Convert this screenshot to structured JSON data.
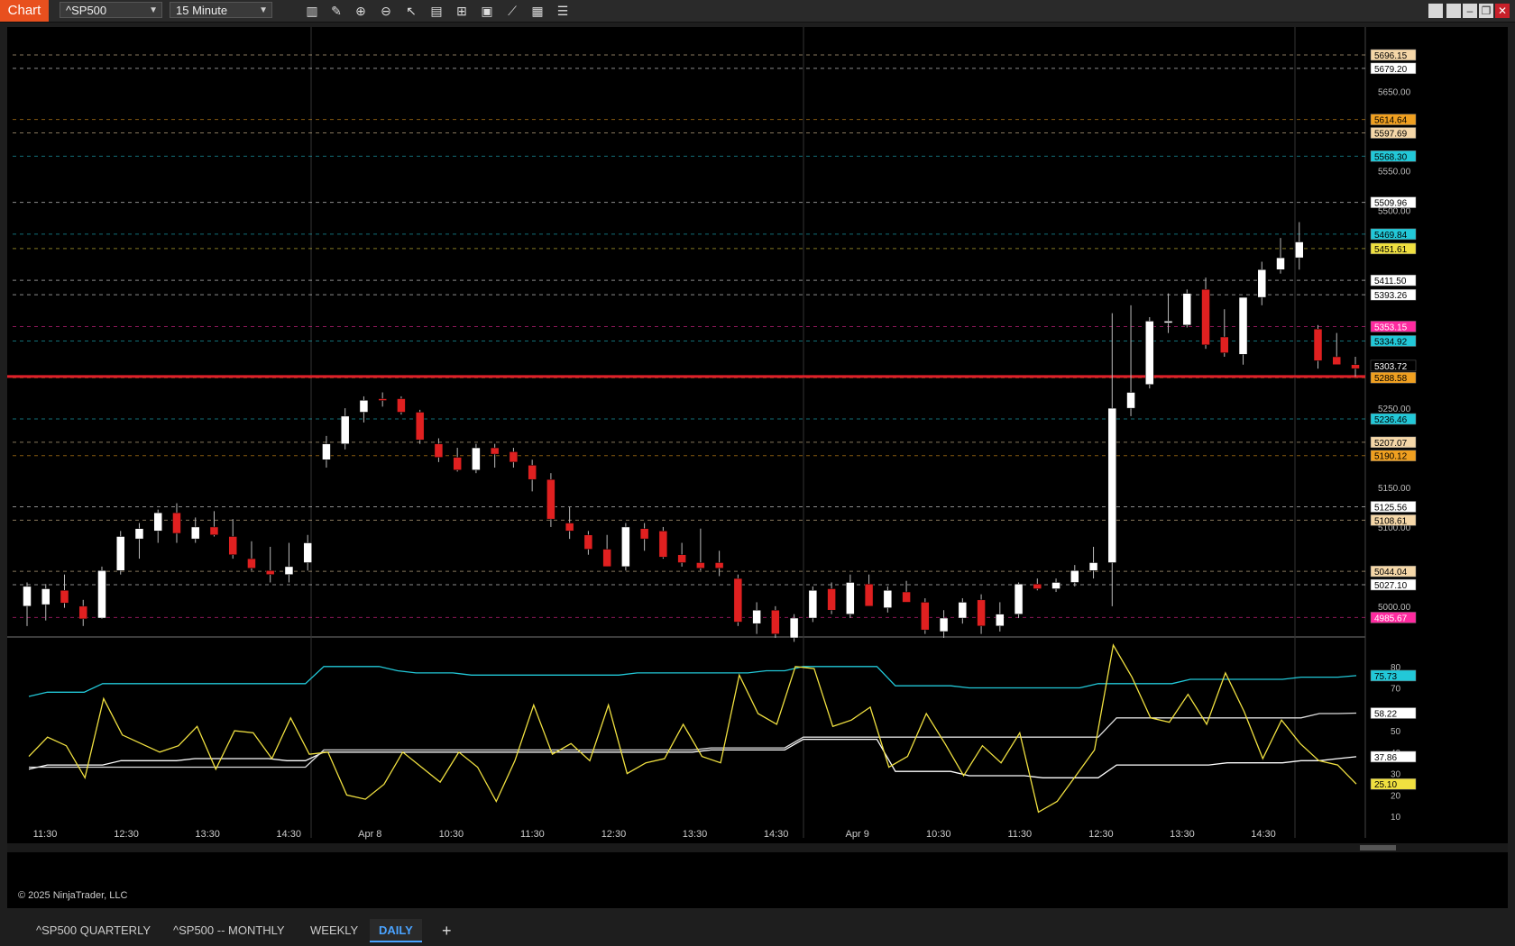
{
  "toolbar": {
    "chart_tab": "Chart",
    "instrument": "^SP500",
    "interval": "15 Minute",
    "tools": [
      "bar-type-icon",
      "draw-icon",
      "zoom-in-icon",
      "zoom-out-icon",
      "pointer-icon",
      "data-box-icon",
      "chart-style-icon",
      "indicators-icon",
      "strategies-icon",
      "properties-icon",
      "more-icon"
    ]
  },
  "price_axis": {
    "ticks": [
      {
        "v": 5650,
        "t": "5650.00"
      },
      {
        "v": 5550,
        "t": "5550.00"
      },
      {
        "v": 5500,
        "t": "5500.00"
      },
      {
        "v": 5250,
        "t": "5250.00"
      },
      {
        "v": 5150,
        "t": "5150.00"
      },
      {
        "v": 5100,
        "t": "5100.00"
      },
      {
        "v": 5000,
        "t": "5000.00"
      }
    ],
    "labels": [
      {
        "v": 5696.15,
        "t": "5696.15",
        "bg": "#f5d7a8",
        "fg": "#000"
      },
      {
        "v": 5679.2,
        "t": "5679.20",
        "bg": "#ffffff",
        "fg": "#000"
      },
      {
        "v": 5614.64,
        "t": "5614.64",
        "bg": "#f0a020",
        "fg": "#000"
      },
      {
        "v": 5597.69,
        "t": "5597.69",
        "bg": "#f5d7a8",
        "fg": "#000"
      },
      {
        "v": 5568.3,
        "t": "5568.30",
        "bg": "#22c8d8",
        "fg": "#000"
      },
      {
        "v": 5509.96,
        "t": "5509.96",
        "bg": "#ffffff",
        "fg": "#000"
      },
      {
        "v": 5469.84,
        "t": "5469.84",
        "bg": "#22c8d8",
        "fg": "#000"
      },
      {
        "v": 5451.61,
        "t": "5451.61",
        "bg": "#f0e040",
        "fg": "#000"
      },
      {
        "v": 5411.5,
        "t": "5411.50",
        "bg": "#ffffff",
        "fg": "#000"
      },
      {
        "v": 5393.26,
        "t": "5393.26",
        "bg": "#ffffff",
        "fg": "#000"
      },
      {
        "v": 5353.15,
        "t": "5353.15",
        "bg": "#ff2aa0",
        "fg": "#fff"
      },
      {
        "v": 5334.92,
        "t": "5334.92",
        "bg": "#22c8d8",
        "fg": "#000"
      },
      {
        "v": 5303.72,
        "t": "5303.72",
        "bg": "#000000",
        "fg": "#fff"
      },
      {
        "v": 5288.58,
        "t": "5288.58",
        "bg": "#f0a020",
        "fg": "#000"
      },
      {
        "v": 5236.46,
        "t": "5236.46",
        "bg": "#22c8d8",
        "fg": "#000"
      },
      {
        "v": 5207.07,
        "t": "5207.07",
        "bg": "#f5d7a8",
        "fg": "#000"
      },
      {
        "v": 5190.12,
        "t": "5190.12",
        "bg": "#f0a020",
        "fg": "#000"
      },
      {
        "v": 5125.56,
        "t": "5125.56",
        "bg": "#ffffff",
        "fg": "#000"
      },
      {
        "v": 5108.61,
        "t": "5108.61",
        "bg": "#f5d7a8",
        "fg": "#000"
      },
      {
        "v": 5044.04,
        "t": "5044.04",
        "bg": "#f5d7a8",
        "fg": "#000"
      },
      {
        "v": 5027.1,
        "t": "5027.10",
        "bg": "#ffffff",
        "fg": "#000"
      },
      {
        "v": 4985.67,
        "t": "4985.67",
        "bg": "#ff2aa0",
        "fg": "#fff"
      }
    ]
  },
  "indicator_axis": {
    "ticks": [
      {
        "v": 80,
        "t": "80"
      },
      {
        "v": 70,
        "t": "70"
      },
      {
        "v": 50,
        "t": "50"
      },
      {
        "v": 40,
        "t": "40"
      },
      {
        "v": 30,
        "t": "30"
      },
      {
        "v": 20,
        "t": "20"
      },
      {
        "v": 10,
        "t": "10"
      }
    ],
    "labels": [
      {
        "v": 75.73,
        "t": "75.73",
        "bg": "#22c8d8",
        "fg": "#000"
      },
      {
        "v": 58.22,
        "t": "58.22",
        "bg": "#ffffff",
        "fg": "#000"
      },
      {
        "v": 37.86,
        "t": "37.86",
        "bg": "#ffffff",
        "fg": "#000"
      },
      {
        "v": 25.1,
        "t": "25.10",
        "bg": "#f0e040",
        "fg": "#000"
      }
    ]
  },
  "time_axis": [
    "11:30",
    "12:30",
    "13:30",
    "14:30",
    "Apr 8",
    "10:30",
    "11:30",
    "12:30",
    "13:30",
    "14:30",
    "Apr 9",
    "10:30",
    "11:30",
    "12:30",
    "13:30",
    "14:30"
  ],
  "copyright": "© 2025 NinjaTrader, LLC",
  "tabs": [
    {
      "label": "^SP500 QUARTERLY",
      "active": false
    },
    {
      "label": "^SP500 -- MONTHLY",
      "active": false
    },
    {
      "label": "WEEKLY",
      "active": false
    },
    {
      "label": "DAILY",
      "active": true
    }
  ],
  "add_tab": "+",
  "colors": {
    "up": "#ffffff",
    "down": "#e02020",
    "background": "#000000",
    "price_line": "#e0202a",
    "cyan": "#22c8d8",
    "orange": "#f0a020",
    "tan": "#e8c898",
    "yellow": "#f0e040",
    "magenta": "#ff2aa0"
  },
  "chart_data": {
    "type": "candlestick",
    "price_range": [
      4960,
      5720
    ],
    "indicator_range": [
      5,
      90
    ],
    "last_price": 5303.72,
    "candles": [
      {
        "o": 5000,
        "h": 5030,
        "l": 4975,
        "c": 5025
      },
      {
        "o": 5002,
        "h": 5028,
        "l": 4982,
        "c": 5022
      },
      {
        "o": 5020,
        "h": 5040,
        "l": 4998,
        "c": 5004
      },
      {
        "o": 5000,
        "h": 5008,
        "l": 4975,
        "c": 4984
      },
      {
        "o": 4985,
        "h": 5050,
        "l": 4984,
        "c": 5045
      },
      {
        "o": 5045,
        "h": 5095,
        "l": 5040,
        "c": 5088
      },
      {
        "o": 5085,
        "h": 5105,
        "l": 5060,
        "c": 5098
      },
      {
        "o": 5095,
        "h": 5122,
        "l": 5080,
        "c": 5118
      },
      {
        "o": 5118,
        "h": 5130,
        "l": 5080,
        "c": 5092
      },
      {
        "o": 5085,
        "h": 5112,
        "l": 5080,
        "c": 5100
      },
      {
        "o": 5100,
        "h": 5120,
        "l": 5088,
        "c": 5090
      },
      {
        "o": 5088,
        "h": 5110,
        "l": 5060,
        "c": 5065
      },
      {
        "o": 5060,
        "h": 5082,
        "l": 5045,
        "c": 5048
      },
      {
        "o": 5045,
        "h": 5075,
        "l": 5030,
        "c": 5040
      },
      {
        "o": 5040,
        "h": 5080,
        "l": 5030,
        "c": 5050
      },
      {
        "o": 5055,
        "h": 5090,
        "l": 5045,
        "c": 5080
      },
      {
        "o": 5185,
        "h": 5215,
        "l": 5175,
        "c": 5205
      },
      {
        "o": 5205,
        "h": 5250,
        "l": 5198,
        "c": 5240
      },
      {
        "o": 5245,
        "h": 5265,
        "l": 5232,
        "c": 5260
      },
      {
        "o": 5262,
        "h": 5270,
        "l": 5252,
        "c": 5260
      },
      {
        "o": 5262,
        "h": 5265,
        "l": 5242,
        "c": 5245
      },
      {
        "o": 5245,
        "h": 5248,
        "l": 5205,
        "c": 5210
      },
      {
        "o": 5205,
        "h": 5212,
        "l": 5182,
        "c": 5188
      },
      {
        "o": 5188,
        "h": 5200,
        "l": 5170,
        "c": 5172
      },
      {
        "o": 5172,
        "h": 5205,
        "l": 5168,
        "c": 5200
      },
      {
        "o": 5200,
        "h": 5205,
        "l": 5175,
        "c": 5192
      },
      {
        "o": 5195,
        "h": 5200,
        "l": 5175,
        "c": 5182
      },
      {
        "o": 5178,
        "h": 5185,
        "l": 5145,
        "c": 5160
      },
      {
        "o": 5160,
        "h": 5168,
        "l": 5100,
        "c": 5110
      },
      {
        "o": 5105,
        "h": 5125,
        "l": 5085,
        "c": 5095
      },
      {
        "o": 5090,
        "h": 5095,
        "l": 5065,
        "c": 5072
      },
      {
        "o": 5072,
        "h": 5090,
        "l": 5050,
        "c": 5050
      },
      {
        "o": 5050,
        "h": 5105,
        "l": 5045,
        "c": 5100
      },
      {
        "o": 5098,
        "h": 5105,
        "l": 5070,
        "c": 5085
      },
      {
        "o": 5095,
        "h": 5100,
        "l": 5060,
        "c": 5062
      },
      {
        "o": 5065,
        "h": 5080,
        "l": 5050,
        "c": 5055
      },
      {
        "o": 5055,
        "h": 5098,
        "l": 5045,
        "c": 5048
      },
      {
        "o": 5055,
        "h": 5070,
        "l": 5038,
        "c": 5048
      },
      {
        "o": 5035,
        "h": 5040,
        "l": 4975,
        "c": 4980
      },
      {
        "o": 4978,
        "h": 5005,
        "l": 4965,
        "c": 4995
      },
      {
        "o": 4995,
        "h": 5000,
        "l": 4960,
        "c": 4965
      },
      {
        "o": 4960,
        "h": 4990,
        "l": 4955,
        "c": 4985
      },
      {
        "o": 4985,
        "h": 5025,
        "l": 4980,
        "c": 5020
      },
      {
        "o": 5022,
        "h": 5030,
        "l": 4990,
        "c": 4995
      },
      {
        "o": 4990,
        "h": 5040,
        "l": 4985,
        "c": 5030
      },
      {
        "o": 5028,
        "h": 5040,
        "l": 5005,
        "c": 5000
      },
      {
        "o": 4998,
        "h": 5025,
        "l": 4992,
        "c": 5020
      },
      {
        "o": 5018,
        "h": 5032,
        "l": 5005,
        "c": 5005
      },
      {
        "o": 5005,
        "h": 5010,
        "l": 4965,
        "c": 4970
      },
      {
        "o": 4968,
        "h": 4995,
        "l": 4960,
        "c": 4985
      },
      {
        "o": 4985,
        "h": 5010,
        "l": 4978,
        "c": 5005
      },
      {
        "o": 5008,
        "h": 5015,
        "l": 4965,
        "c": 4975
      },
      {
        "o": 4975,
        "h": 5005,
        "l": 4968,
        "c": 4990
      },
      {
        "o": 4990,
        "h": 5030,
        "l": 4985,
        "c": 5028
      },
      {
        "o": 5028,
        "h": 5035,
        "l": 5020,
        "c": 5022
      },
      {
        "o": 5022,
        "h": 5035,
        "l": 5018,
        "c": 5030
      },
      {
        "o": 5030,
        "h": 5052,
        "l": 5025,
        "c": 5045
      },
      {
        "o": 5045,
        "h": 5075,
        "l": 5035,
        "c": 5055
      },
      {
        "o": 5055,
        "h": 5370,
        "l": 5000,
        "c": 5250
      },
      {
        "o": 5250,
        "h": 5380,
        "l": 5240,
        "c": 5270
      },
      {
        "o": 5280,
        "h": 5365,
        "l": 5275,
        "c": 5360
      },
      {
        "o": 5360,
        "h": 5395,
        "l": 5345,
        "c": 5360
      },
      {
        "o": 5355,
        "h": 5400,
        "l": 5352,
        "c": 5395
      },
      {
        "o": 5400,
        "h": 5415,
        "l": 5325,
        "c": 5330
      },
      {
        "o": 5340,
        "h": 5375,
        "l": 5315,
        "c": 5320
      },
      {
        "o": 5318,
        "h": 5390,
        "l": 5305,
        "c": 5390
      },
      {
        "o": 5390,
        "h": 5435,
        "l": 5380,
        "c": 5425
      },
      {
        "o": 5425,
        "h": 5465,
        "l": 5420,
        "c": 5440
      },
      {
        "o": 5440,
        "h": 5485,
        "l": 5425,
        "c": 5460
      },
      {
        "o": 5350,
        "h": 5355,
        "l": 5300,
        "c": 5310
      },
      {
        "o": 5315,
        "h": 5345,
        "l": 5305,
        "c": 5305
      },
      {
        "o": 5305,
        "h": 5315,
        "l": 5290,
        "c": 5300
      }
    ],
    "indicators": {
      "cyan": [
        66,
        68,
        68,
        68,
        72,
        72,
        72,
        72,
        72,
        72,
        72,
        72,
        72,
        72,
        72,
        72,
        80,
        80,
        80,
        80,
        78,
        77,
        77,
        77,
        76,
        76,
        76,
        76,
        76,
        76,
        76,
        76,
        76,
        77,
        77,
        77,
        77,
        77,
        77,
        77,
        78,
        78,
        80,
        80,
        80,
        80,
        80,
        71,
        71,
        71,
        71,
        70,
        70,
        70,
        70,
        70,
        70,
        70,
        72,
        72,
        72,
        72,
        72,
        74,
        74,
        74,
        74,
        74,
        74,
        75,
        75,
        75,
        75.73
      ],
      "white": [
        32,
        34,
        34,
        34,
        34,
        36,
        36,
        36,
        36,
        37,
        37,
        37,
        37,
        37,
        36,
        36,
        40,
        40,
        40,
        40,
        40,
        40,
        40,
        40,
        40,
        40,
        40,
        40,
        40,
        40,
        40,
        40,
        40,
        40,
        40,
        40,
        40,
        41,
        41,
        41,
        41,
        41,
        46,
        46,
        46,
        46,
        46,
        31,
        31,
        31,
        31,
        29,
        29,
        29,
        29,
        28,
        28,
        28,
        28,
        34,
        34,
        34,
        34,
        34,
        34,
        35,
        35,
        35,
        35,
        36,
        36,
        37,
        37.86
      ],
      "white2": [
        33,
        33,
        33,
        33,
        33,
        33,
        33,
        33,
        33,
        33,
        33,
        33,
        33,
        33,
        33,
        33,
        41,
        41,
        41,
        41,
        41,
        41,
        41,
        41,
        41,
        41,
        41,
        41,
        41,
        41,
        41,
        41,
        41,
        41,
        41,
        41,
        41,
        42,
        42,
        42,
        42,
        42,
        47,
        47,
        47,
        47,
        47,
        47,
        47,
        47,
        47,
        47,
        47,
        47,
        47,
        47,
        47,
        47,
        47,
        56,
        56,
        56,
        56,
        56,
        56,
        56,
        56,
        56,
        56,
        56,
        58,
        58,
        58.22
      ],
      "yellow": [
        38,
        47,
        43,
        28,
        65,
        48,
        44,
        40,
        43,
        52,
        32,
        50,
        49,
        37,
        56,
        39,
        40,
        20,
        18,
        25,
        40,
        33,
        26,
        40,
        33,
        17,
        36,
        62,
        39,
        44,
        36,
        62,
        30,
        35,
        37,
        53,
        38,
        35,
        76,
        58,
        53,
        80,
        79,
        52,
        55,
        61,
        33,
        38,
        58,
        44,
        29,
        43,
        35,
        49,
        12,
        17,
        29,
        41,
        90,
        75,
        56,
        54,
        67,
        53,
        77,
        59,
        37,
        55,
        44,
        36,
        34,
        25.1
      ]
    }
  }
}
